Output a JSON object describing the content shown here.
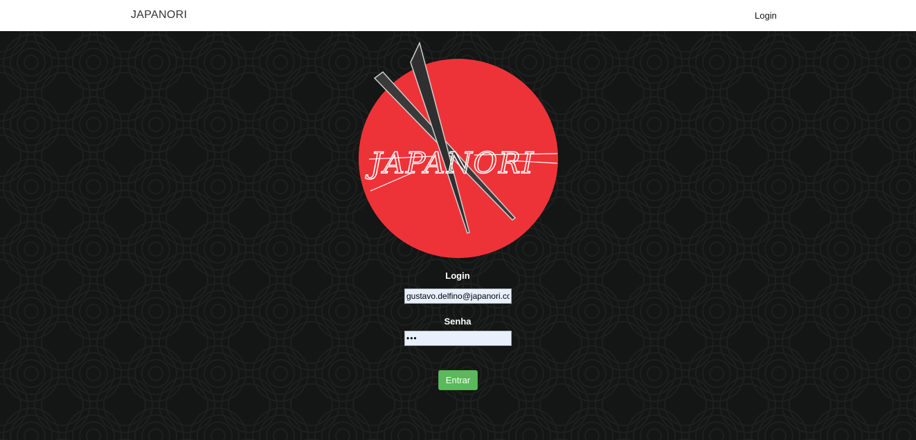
{
  "navbar": {
    "brand": "JAPANORI",
    "login_link": "Login"
  },
  "logo": {
    "text": "JAPANORI",
    "circle_color": "#ee3338"
  },
  "form": {
    "login_label": "Login",
    "login_value": "gustavo.delfino@japanori.com",
    "password_label": "Senha",
    "password_value": "123",
    "submit_label": "Entrar"
  },
  "colors": {
    "navbar_bg": "#ffffff",
    "page_bg": "#151515",
    "button_bg": "#5cb85c",
    "input_bg": "#e8f0fe"
  }
}
